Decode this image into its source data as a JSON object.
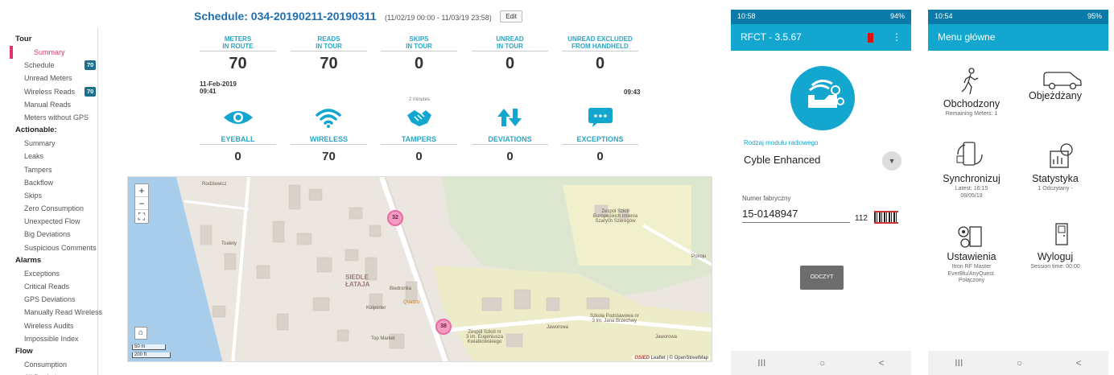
{
  "schedule": {
    "title": "Schedule: 034-20190211-20190311",
    "range": "(11/02/19 00:00 - 11/03/19 23:58)",
    "edit_label": "Edit"
  },
  "sidebar": {
    "sections": [
      {
        "label": "Tour",
        "items": [
          {
            "label": "Summary",
            "active": true
          },
          {
            "label": "Schedule",
            "badge": "70"
          },
          {
            "label": "Unread Meters"
          },
          {
            "label": "Wireless Reads",
            "badge": "70"
          },
          {
            "label": "Manual Reads"
          },
          {
            "label": "Meters without GPS"
          }
        ]
      },
      {
        "label": "Actionable:",
        "items": [
          {
            "label": "Summary"
          },
          {
            "label": "Leaks"
          },
          {
            "label": "Tampers"
          },
          {
            "label": "Backflow"
          },
          {
            "label": "Skips"
          },
          {
            "label": "Zero Consumption"
          },
          {
            "label": "Unexpected Flow"
          },
          {
            "label": "Big Deviations"
          },
          {
            "label": "Suspicious Comments"
          }
        ]
      },
      {
        "label": "Alarms",
        "items": [
          {
            "label": "Exceptions"
          },
          {
            "label": "Critical Reads"
          },
          {
            "label": "GPS Deviations"
          },
          {
            "label": "Manually Read Wireless"
          },
          {
            "label": "Wireless Audits"
          },
          {
            "label": "Impossible Index"
          }
        ]
      },
      {
        "label": "Flow",
        "items": [
          {
            "label": "Consumption"
          },
          {
            "label": "All Deviations"
          }
        ]
      }
    ]
  },
  "stats": [
    {
      "label": "METERS\nIN ROUTE",
      "value": "70"
    },
    {
      "label": "READS\nIN TOUR",
      "value": "70"
    },
    {
      "label": "SKIPS\nIN TOUR",
      "value": "0"
    },
    {
      "label": "UNREAD\nIN TOUR",
      "value": "0"
    },
    {
      "label": "UNREAD EXCLUDED\nFROM HANDHELD",
      "value": "0"
    }
  ],
  "timeline": {
    "start_date": "11-Feb-2019",
    "start_time": "09:41",
    "end_time": "09:43",
    "duration": "2 minutes"
  },
  "events": [
    {
      "label": "EYEBALL",
      "value": "0",
      "icon": "eye-icon"
    },
    {
      "label": "WIRELESS",
      "value": "70",
      "icon": "wifi-icon"
    },
    {
      "label": "TAMPERS",
      "value": "0",
      "icon": "handshake-icon"
    },
    {
      "label": "DEVIATIONS",
      "value": "0",
      "icon": "arrows-up-down-icon"
    },
    {
      "label": "EXCEPTIONS",
      "value": "0",
      "icon": "chat-bubble-icon"
    }
  ],
  "map": {
    "zoom_in": "+",
    "zoom_out": "−",
    "scale_m": "50 m",
    "scale_ft": "200 ft",
    "attribution": "Leaflet | © OpenStreetMap",
    "watermark": "OSIED",
    "clusters": [
      "32",
      "38"
    ],
    "labels": {
      "rodziewicz": "Rodziewicz",
      "toalety": "Toalety",
      "siedle": "SIEDLE\nŁATAJA",
      "biedronka": "Biedronka",
      "quattro": "Quattro",
      "kolporter": "Kolporter",
      "topmarket": "Top Market",
      "jaworowa1": "Jaworowa",
      "jaworowa2": "Jaworowa",
      "zespol1": "Zespół Szkół\nEuropejskich imienia\nSzarych Szeregów",
      "zespol2": "Zespół Szkół nr\n3 im. Eugeniusza\nKwiatkowskiego",
      "szkola": "Szkoła Podstawowa nr\n3 im. Jana Brzechwy",
      "pokoju": "Pokoju"
    }
  },
  "phone1": {
    "status_time": "10:58",
    "status_right": "94%",
    "app_title": "RFCT - 3.5.67",
    "module_label": "Rodzaj modułu radiowego",
    "module_value": "Cyble Enhanced",
    "serial_label": "Numer fabryczny",
    "serial_value": "15-0148947",
    "serial_suffix": "112",
    "read_button": "ODCZYT",
    "nav": [
      "III",
      "○",
      "<"
    ]
  },
  "phone2": {
    "status_time": "10:54",
    "status_right": "95%",
    "app_title": "Menu główne",
    "items": [
      {
        "title": "Obchodzony",
        "sub": "Remaining Meters: 1",
        "icon": "walking-person-icon"
      },
      {
        "title": "Objeżdżany",
        "sub": "",
        "icon": "van-icon"
      },
      {
        "title": "Synchronizuj",
        "sub": "Latest: 16:15\n08/05/19",
        "icon": "sync-phone-icon"
      },
      {
        "title": "Statystyka",
        "sub": "1 Odczytany -",
        "icon": "statistics-icon"
      },
      {
        "title": "Ustawienia",
        "sub": "Itron RF Master\nEverBlu/AnyQuest.\nPołączony",
        "icon": "settings-icon"
      },
      {
        "title": "Wyloguj",
        "sub": "Session time: 00:00",
        "icon": "door-icon"
      }
    ],
    "nav": [
      "III",
      "○",
      "<"
    ]
  },
  "colors": {
    "accent": "#13a7d0",
    "stat_label": "#29a6c5",
    "active": "#e0336f",
    "cluster": "#f49bc1"
  }
}
